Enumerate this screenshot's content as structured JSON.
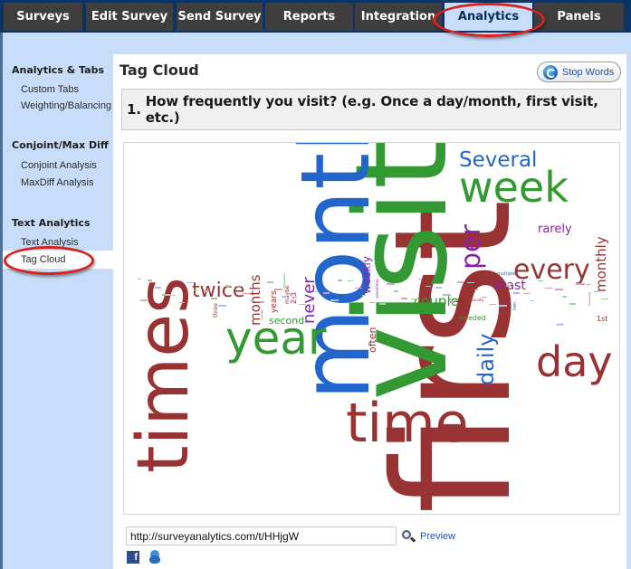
{
  "nav": {
    "tabs": [
      {
        "label": "Surveys",
        "active": false
      },
      {
        "label": "Edit Survey",
        "active": false
      },
      {
        "label": "Send Survey",
        "active": false
      },
      {
        "label": "Reports",
        "active": false
      },
      {
        "label": "Integration",
        "active": false
      },
      {
        "label": "Analytics",
        "active": true
      },
      {
        "label": "Panels",
        "active": false
      }
    ]
  },
  "sidebar": {
    "sections": [
      {
        "heading": "Analytics & Tabs",
        "items": [
          "Custom Tabs",
          "Weighting/Balancing"
        ]
      },
      {
        "heading": "Conjoint/Max Diff",
        "items": [
          "Conjoint Analysis",
          "MaxDiff Analysis"
        ]
      },
      {
        "heading": "Text Analytics",
        "items": [
          "Text Analysis",
          "Tag Cloud"
        ]
      }
    ],
    "active_item": "Tag Cloud"
  },
  "main": {
    "title": "Tag Cloud",
    "stop_words_label": "Stop Words",
    "question": {
      "number": "1.",
      "text": "How frequently you visit? (e.g. Once a day/month, first visit, etc.)"
    },
    "share_url": "http://surveyanalytics.com/t/HHjgW",
    "preview_label": "Preview",
    "share_icons": [
      "facebook-icon",
      "twitter-icon"
    ]
  },
  "colors": {
    "red": "#993333",
    "green": "#339933",
    "blue": "#2266cc",
    "purple": "#8822aa",
    "nav_bg": "#403d3e",
    "nav_active": "#c7ddf9",
    "frame": "#c7ddf9",
    "highlight": "#d8221c"
  },
  "tag_cloud": {
    "words": [
      {
        "text": "first",
        "color": "red",
        "vertical": true
      },
      {
        "text": "visit",
        "color": "green",
        "vertical": true
      },
      {
        "text": "month",
        "color": "blue",
        "vertical": true
      },
      {
        "text": "times",
        "color": "red",
        "vertical": true
      },
      {
        "text": "time",
        "color": "red",
        "vertical": false
      },
      {
        "text": "week",
        "color": "green",
        "vertical": false
      },
      {
        "text": "year",
        "color": "green",
        "vertical": false
      },
      {
        "text": "day",
        "color": "red",
        "vertical": false
      },
      {
        "text": "every",
        "color": "red",
        "vertical": false
      },
      {
        "text": "per",
        "color": "purple",
        "vertical": true
      },
      {
        "text": "Several",
        "color": "blue",
        "vertical": false
      },
      {
        "text": "daily",
        "color": "blue",
        "vertical": true
      },
      {
        "text": "twice",
        "color": "red",
        "vertical": false
      },
      {
        "text": "never",
        "color": "purple",
        "vertical": true
      },
      {
        "text": "months",
        "color": "red",
        "vertical": true
      },
      {
        "text": "rarely",
        "color": "purple",
        "vertical": false
      },
      {
        "text": "monthly",
        "color": "red",
        "vertical": true
      },
      {
        "text": "couple",
        "color": "green",
        "vertical": false
      },
      {
        "text": "weekly",
        "color": "purple",
        "vertical": true
      },
      {
        "text": "least",
        "color": "purple",
        "vertical": false
      },
      {
        "text": "second",
        "color": "green",
        "vertical": false
      },
      {
        "text": "often",
        "color": "red",
        "vertical": true
      },
      {
        "text": "years",
        "color": "red",
        "vertical": true
      },
      {
        "text": "needed",
        "color": "green",
        "vertical": false
      },
      {
        "text": "1st",
        "color": "red",
        "vertical": false
      },
      {
        "text": "2-3",
        "color": "red",
        "vertical": true
      },
      {
        "text": "maybe",
        "color": "red",
        "vertical": true
      },
      {
        "text": "three",
        "color": "red",
        "vertical": true
      },
      {
        "text": "multiple",
        "color": "blue",
        "vertical": false
      },
      {
        "text": "ever",
        "color": "green",
        "vertical": false
      },
      {
        "text": "occasionally",
        "color": "red",
        "vertical": false
      },
      {
        "text": "sometimes",
        "color": "purple",
        "vertical": true
      },
      {
        "text": "two",
        "color": "blue",
        "vertical": true
      },
      {
        "text": "one",
        "color": "blue",
        "vertical": false
      },
      {
        "text": "average",
        "color": "red",
        "vertical": true
      },
      {
        "text": "infrequently",
        "color": "green",
        "vertical": true
      },
      {
        "text": "frequently",
        "color": "red",
        "vertical": true
      }
    ]
  }
}
